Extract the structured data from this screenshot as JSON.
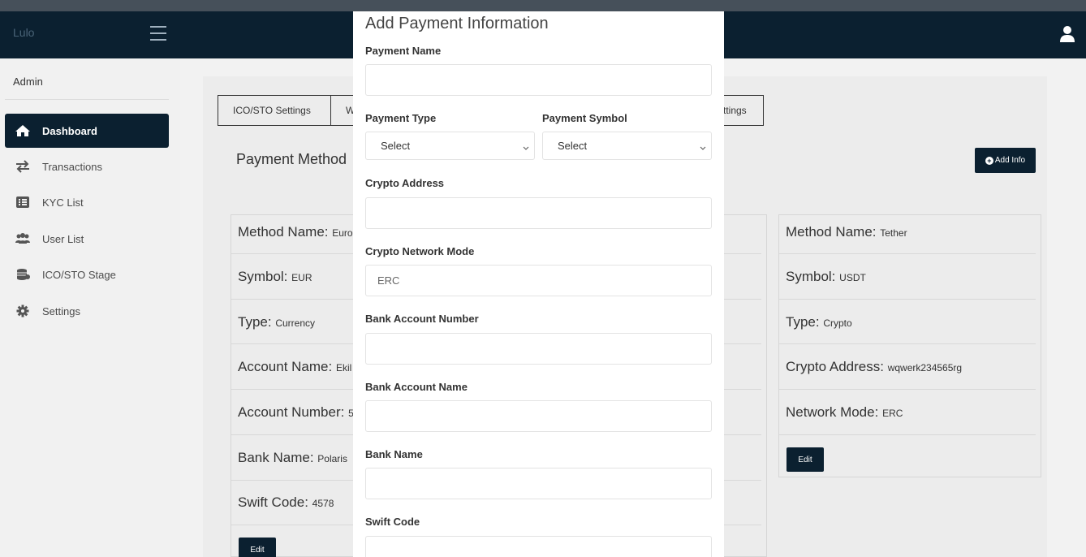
{
  "header": {
    "brand": "Lulo"
  },
  "sidebar": {
    "admin_label": "Admin",
    "items": [
      {
        "label": "Dashboard",
        "icon": "home-icon",
        "active": true
      },
      {
        "label": "Transactions",
        "icon": "exchange-icon"
      },
      {
        "label": "KYC List",
        "icon": "list-icon"
      },
      {
        "label": "User List",
        "icon": "users-icon"
      },
      {
        "label": "ICO/STO Stage",
        "icon": "coins-icon"
      },
      {
        "label": "Settings",
        "icon": "gear-icon"
      }
    ]
  },
  "main": {
    "tabs": [
      {
        "label": "ICO/STO Settings"
      },
      {
        "label": "W"
      },
      {
        "label": "ttings"
      }
    ],
    "section_title": "Payment Method",
    "add_info_label": "Add Info",
    "card_left": {
      "rows": [
        {
          "key": "Method Name:",
          "value": "Euro"
        },
        {
          "key": "Symbol:",
          "value": "EUR"
        },
        {
          "key": "Type:",
          "value": "Currency"
        },
        {
          "key": "Account Name:",
          "value": "Ekil"
        },
        {
          "key": "Account Number:",
          "value": "5"
        },
        {
          "key": "Bank Name:",
          "value": "Polaris"
        },
        {
          "key": "Swift Code:",
          "value": "4578"
        }
      ],
      "edit_label": "Edit"
    },
    "card_right": {
      "rows": [
        {
          "key": "Method Name:",
          "value": "Tether"
        },
        {
          "key": "Symbol:",
          "value": "USDT"
        },
        {
          "key": "Type:",
          "value": "Crypto"
        },
        {
          "key": "Crypto Address:",
          "value": "wqwerk234565rg"
        },
        {
          "key": "Network Mode:",
          "value": "ERC"
        }
      ],
      "edit_label": "Edit"
    }
  },
  "modal": {
    "title": "Add Payment Information",
    "payment_name_label": "Payment Name",
    "payment_name_value": "",
    "payment_type_label": "Payment Type",
    "payment_type_value": "Select",
    "payment_symbol_label": "Payment Symbol",
    "payment_symbol_value": "Select",
    "crypto_address_label": "Crypto Address",
    "crypto_address_value": "",
    "network_mode_label": "Crypto Network Mode",
    "network_mode_value": "ERC",
    "bank_account_number_label": "Bank Account Number",
    "bank_account_number_value": "",
    "bank_account_name_label": "Bank Account Name",
    "bank_account_name_value": "",
    "bank_name_label": "Bank Name",
    "bank_name_value": "",
    "swift_code_label": "Swift Code",
    "swift_code_value": ""
  },
  "colors": {
    "navy": "#0b2030",
    "background": "#f2f2f2",
    "card": "#ececec"
  }
}
